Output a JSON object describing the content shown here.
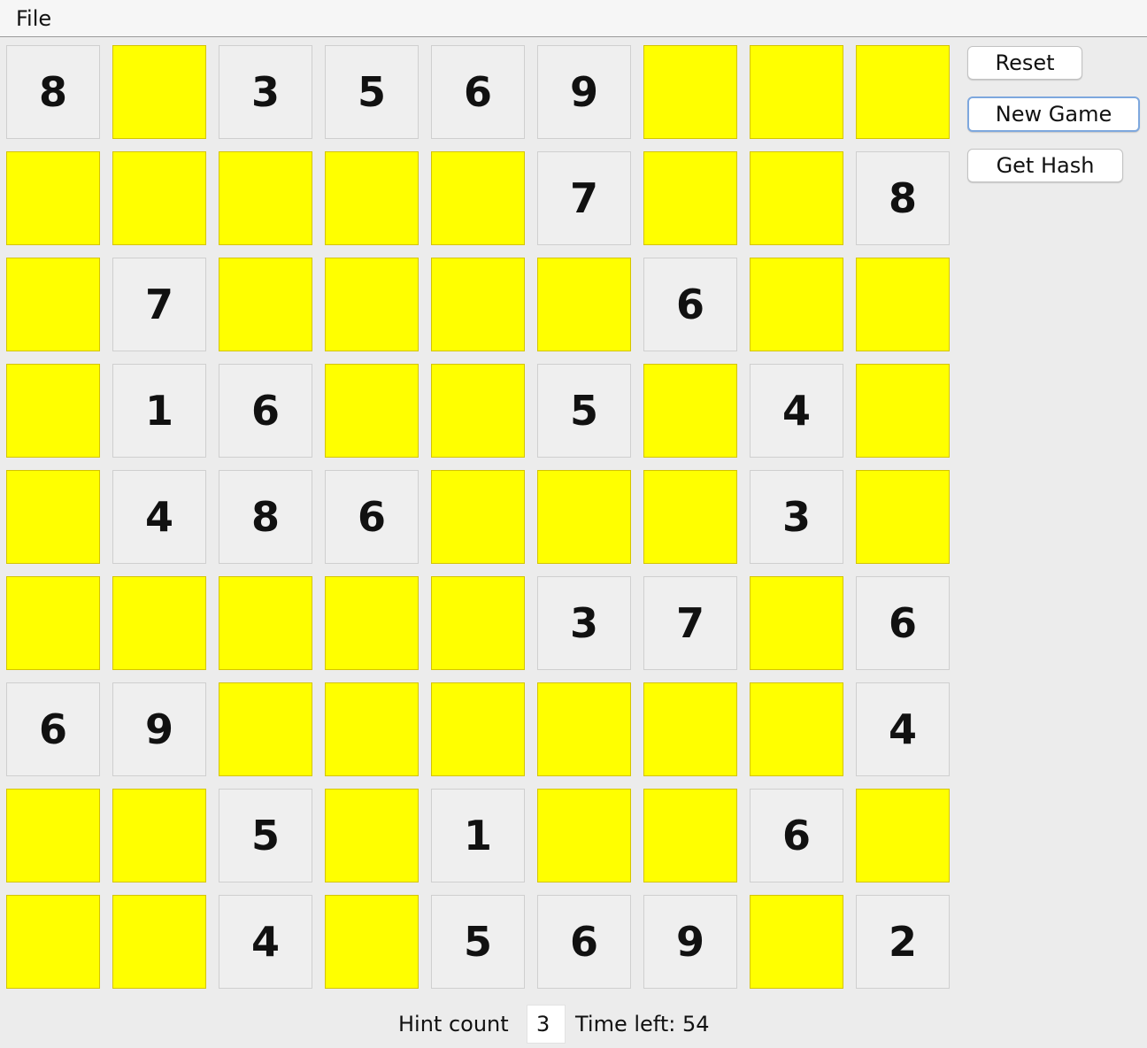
{
  "menu": {
    "file_label": "File"
  },
  "grid": [
    [
      "8",
      "",
      "3",
      "5",
      "6",
      "9",
      "",
      "",
      ""
    ],
    [
      "",
      "",
      "",
      "",
      "",
      "7",
      "",
      "",
      "8"
    ],
    [
      "",
      "7",
      "",
      "",
      "",
      "",
      "6",
      "",
      ""
    ],
    [
      "",
      "1",
      "6",
      "",
      "",
      "5",
      "",
      "4",
      ""
    ],
    [
      "",
      "4",
      "8",
      "6",
      "",
      "",
      "",
      "3",
      ""
    ],
    [
      "",
      "",
      "",
      "",
      "",
      "3",
      "7",
      "",
      "6"
    ],
    [
      "6",
      "9",
      "",
      "",
      "",
      "",
      "",
      "",
      "4"
    ],
    [
      "",
      "",
      "5",
      "",
      "1",
      "",
      "",
      "6",
      ""
    ],
    [
      "",
      "",
      "4",
      "",
      "5",
      "6",
      "9",
      "",
      "2"
    ]
  ],
  "buttons": {
    "reset_label": "Reset",
    "new_game_label": "New Game",
    "get_hash_label": "Get Hash"
  },
  "status": {
    "hint_label": "Hint count",
    "hint_value": "3",
    "time_label": "Time left: 54"
  },
  "colors": {
    "empty_cell": "#ffff00",
    "given_cell": "#efefef"
  }
}
